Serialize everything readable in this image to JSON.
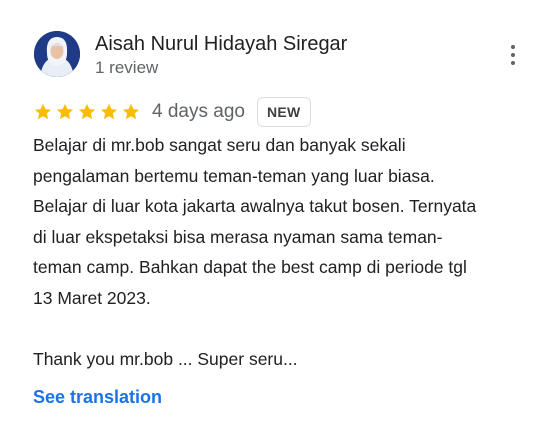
{
  "reviewer": {
    "name": "Aisah Nurul Hidayah Siregar",
    "review_count": "1 review",
    "avatar": "hijab-avatar-icon"
  },
  "review": {
    "rating": 5,
    "max_rating": 5,
    "time_ago": "4 days ago",
    "badge": "NEW",
    "text": "Belajar di mr.bob sangat seru dan banyak sekali\npengalaman bertemu teman-teman yang luar biasa.\nBelajar di luar kota jakarta awalnya takut bosen. Ternyata\ndi luar ekspetaksi bisa merasa nyaman sama teman-\nteman camp. Bahkan dapat the best camp di periode tgl\n13 Maret 2023.\n\nThank you mr.bob ... Super seru...",
    "translate_label": "See translation"
  },
  "icons": {
    "more_menu": "more-vert-icon",
    "star": "star-icon"
  },
  "colors": {
    "star": "#fbbc04",
    "link": "#1a73e8",
    "secondary_text": "#5f6368",
    "avatar_background": "#1f3a86"
  }
}
